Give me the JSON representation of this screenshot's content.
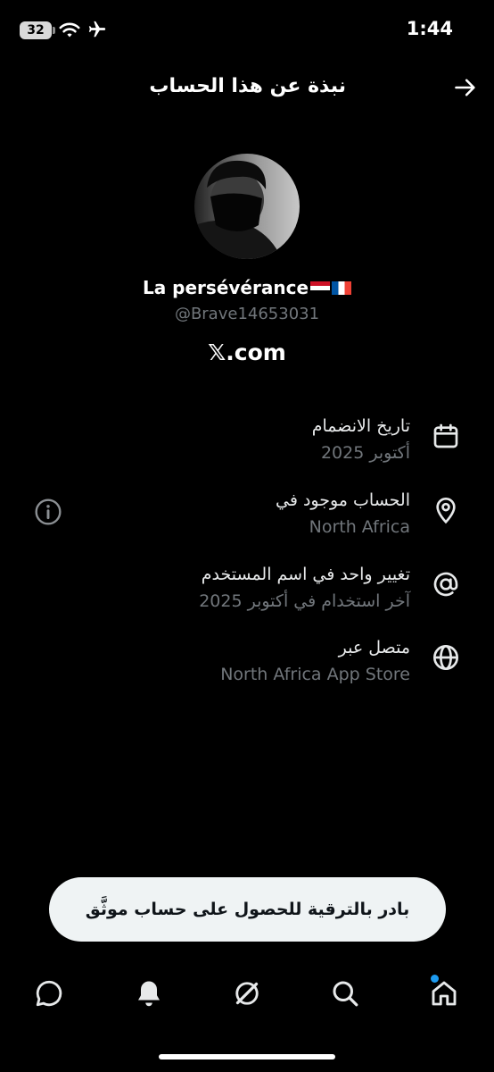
{
  "status_bar": {
    "battery_level": "32",
    "time": "1:44",
    "icons": [
      "wifi-icon",
      "airplane-icon"
    ]
  },
  "header": {
    "title": "نبذة عن هذا الحساب",
    "back_icon": "arrow-right-icon"
  },
  "profile": {
    "display_name": "La persévérance",
    "flags": [
      "egypt-flag-icon",
      "france-flag-icon"
    ],
    "username": "@Brave14653031",
    "platform": "𝕏.com"
  },
  "info_rows": [
    {
      "icon": "calendar-icon",
      "title": "تاريخ الانضمام",
      "value": "أكتوبر 2025"
    },
    {
      "icon": "location-pin-icon",
      "title": "الحساب موجود في",
      "value": "North Africa"
    },
    {
      "icon": "at-sign-icon",
      "title": "تغيير واحد في اسم المستخدم",
      "value": "آخر استخدام في أكتوبر 2025"
    },
    {
      "icon": "globe-icon",
      "title": "متصل عبر",
      "value": "North Africa App Store"
    }
  ],
  "upgrade_button": {
    "label": "بادر بالترقية للحصول على حساب موثَّق"
  },
  "bottom_nav": {
    "items": [
      "messages-icon",
      "notifications-icon",
      "grok-icon",
      "search-icon",
      "home-icon"
    ],
    "accent": "#1d9bf0"
  },
  "colors": {
    "background": "#000000",
    "secondary_text": "#71767b",
    "pill_background": "#eff3f4"
  }
}
